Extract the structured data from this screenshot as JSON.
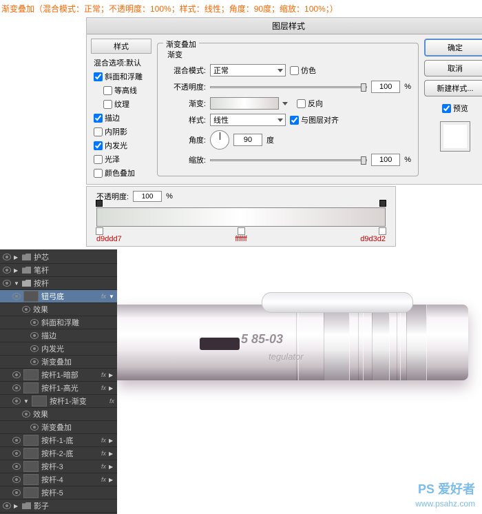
{
  "annotation": "渐变叠加（混合模式：正常；不透明度：100%；样式：线性；角度：90度；缩放：100%；）",
  "dialog": {
    "title": "图层样式",
    "styles_header": "样式",
    "styles": {
      "blend_default": "混合选项:默认",
      "bevel": "斜面和浮雕",
      "contour": "等高线",
      "texture": "纹理",
      "stroke": "描边",
      "inner_shadow": "内阴影",
      "inner_glow": "内发光",
      "satin": "光泽",
      "color_overlay": "颜色叠加"
    },
    "panel": {
      "group": "渐变叠加",
      "subgroup": "渐变",
      "blend_label": "混合模式:",
      "blend_value": "正常",
      "dither": "仿色",
      "opacity_label": "不透明度:",
      "opacity_value": "100",
      "gradient_label": "渐变:",
      "reverse": "反向",
      "style_label": "样式:",
      "style_value": "线性",
      "align": "与图层对齐",
      "angle_label": "角度:",
      "angle_value": "90",
      "angle_unit": "度",
      "scale_label": "缩放:",
      "scale_value": "100",
      "pct": "%"
    },
    "buttons": {
      "ok": "确定",
      "cancel": "取消",
      "new_style": "新建样式...",
      "preview": "预览"
    }
  },
  "grad_editor": {
    "opacity_label": "不透明度:",
    "opacity_value": "100",
    "pct": "%",
    "stops": [
      "d9ddd7",
      "ffffff",
      "d9d3d2"
    ]
  },
  "layers": {
    "huxin": "护芯",
    "bigan": "笔杆",
    "angan": "按杆",
    "niugdi": "钮弓底",
    "fx": "fx",
    "effects": "效果",
    "bevel": "斜面和浮雕",
    "stroke": "描边",
    "inner_glow": "内发光",
    "grad_overlay": "渐变叠加",
    "angan1_dark": "按杆1-暗部",
    "angan1_high": "按杆1-高光",
    "angan1_grad": "按杆1-渐变",
    "angan1_di": "按杆-1-底",
    "angan2_di": "按杆-2-底",
    "angan3": "按杆-3",
    "angan4": "按杆-4",
    "angan5": "按杆-5",
    "shadow": "影子"
  },
  "pen": {
    "code": "5 85-03",
    "label": "tegulator"
  },
  "watermark": {
    "line1": "PS 爱好者",
    "line2": "www.psahz.com"
  }
}
